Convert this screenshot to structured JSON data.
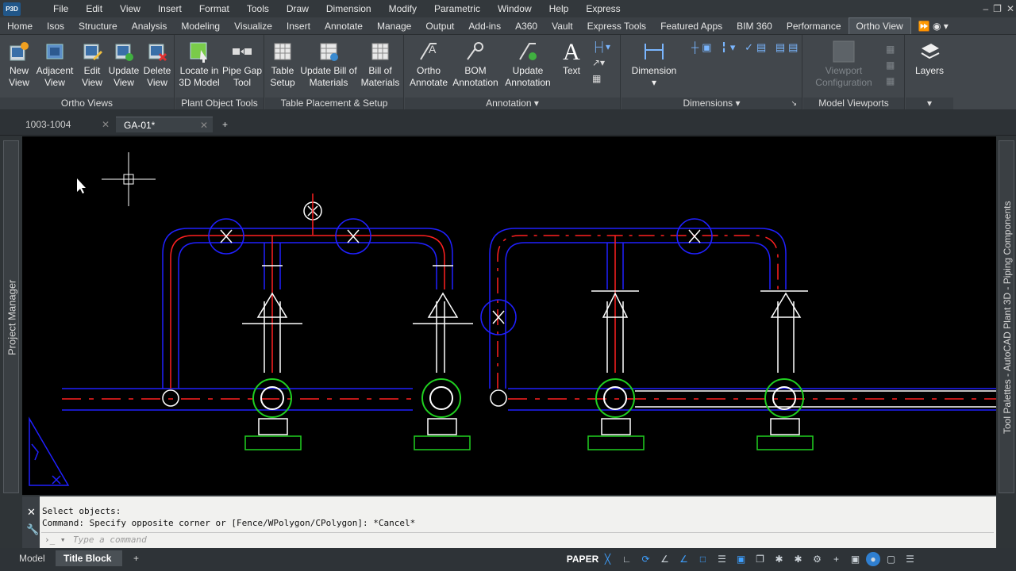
{
  "menubar": {
    "logo": "P3D",
    "items": [
      "File",
      "Edit",
      "View",
      "Insert",
      "Format",
      "Tools",
      "Draw",
      "Dimension",
      "Modify",
      "Parametric",
      "Window",
      "Help",
      "Express"
    ]
  },
  "ribbon_tabs": [
    "Home",
    "Isos",
    "Structure",
    "Analysis",
    "Modeling",
    "Visualize",
    "Insert",
    "Annotate",
    "Manage",
    "Output",
    "Add-ins",
    "A360",
    "Vault",
    "Express Tools",
    "Featured Apps",
    "BIM 360",
    "Performance",
    "Ortho View"
  ],
  "active_tab": "Ortho View",
  "panels": {
    "ortho_views": {
      "title": "Ortho Views",
      "buttons": [
        {
          "l1": "New",
          "l2": "View"
        },
        {
          "l1": "Adjacent",
          "l2": "View"
        },
        {
          "l1": "Edit",
          "l2": "View"
        },
        {
          "l1": "Update",
          "l2": "View"
        },
        {
          "l1": "Delete",
          "l2": "View"
        }
      ]
    },
    "plant_object_tools": {
      "title": "Plant Object Tools",
      "buttons": [
        {
          "l1": "Locate in",
          "l2": "3D Model"
        },
        {
          "l1": "Pipe Gap",
          "l2": "Tool"
        }
      ]
    },
    "table_placement": {
      "title": "Table Placement & Setup",
      "buttons": [
        {
          "l1": "Table",
          "l2": "Setup"
        },
        {
          "l1": "Update Bill of",
          "l2": "Materials"
        },
        {
          "l1": "Bill of",
          "l2": "Materials"
        }
      ]
    },
    "annotation": {
      "title": "Annotation",
      "buttons": [
        {
          "l1": "Ortho",
          "l2": "Annotate"
        },
        {
          "l1": "BOM",
          "l2": "Annotation"
        },
        {
          "l1": "Update",
          "l2": "Annotation"
        },
        {
          "l1": "Text",
          "l2": ""
        }
      ]
    },
    "dimensions": {
      "title": "Dimensions",
      "buttons": [
        {
          "l1": "Dimension",
          "l2": ""
        }
      ]
    },
    "model_viewports": {
      "title": "Model Viewports",
      "buttons": [
        {
          "l1": "Viewport",
          "l2": "Configuration"
        }
      ]
    },
    "layers": {
      "title": "",
      "buttons": [
        {
          "l1": "Layers",
          "l2": ""
        }
      ]
    }
  },
  "doc_tabs": [
    "1003-1004",
    "GA-01*"
  ],
  "left_palette": "Project Manager",
  "right_palette": "Tool Palettes - AutoCAD Plant 3D - Piping Components",
  "command": {
    "line1": "Select objects:",
    "line2": "Command: Specify opposite corner or [Fence/WPolygon/CPolygon]: *Cancel*",
    "placeholder": "Type a command"
  },
  "layout_tabs": [
    "Model",
    "Title Block"
  ],
  "status": {
    "paper": "PAPER"
  },
  "colors": {
    "pipe_blue": "#2020ff",
    "pipe_red": "#ff2020",
    "pump_green": "#20d020",
    "bg": "#000000",
    "ui": "#42474c"
  }
}
